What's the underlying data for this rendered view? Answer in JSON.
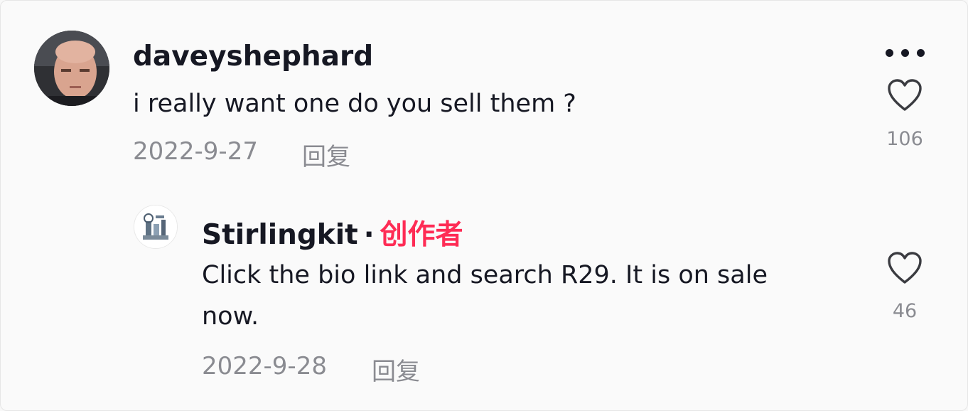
{
  "comments": [
    {
      "username": "daveyshephard",
      "text": "i really want one do you sell them ?",
      "date": "2022-9-27",
      "reply_label": "回复",
      "like_count": "106"
    }
  ],
  "reply": {
    "username": "Stirlingkit",
    "separator": "·",
    "creator_badge": "创作者",
    "text": "Click the bio link and search R29. It is on sale now.",
    "date": "2022-9-28",
    "reply_label": "回复",
    "like_count": "46"
  },
  "colors": {
    "creator_accent": "#fe2c55",
    "primary_text": "#161823",
    "secondary_text": "#8a8b91"
  },
  "icons": {
    "more": "more-options-icon",
    "like": "heart-outline-icon"
  }
}
